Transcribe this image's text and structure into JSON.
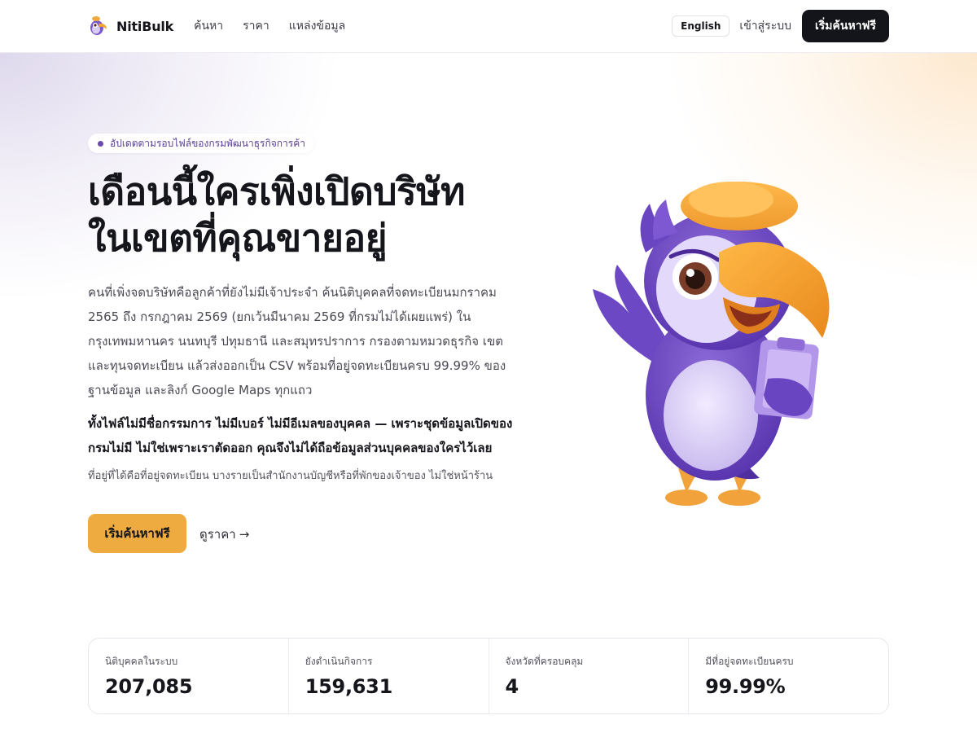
{
  "nav": {
    "brand": "NitiBulk",
    "links": [
      "ค้นหา",
      "ราคา",
      "แหล่งข้อมูล"
    ],
    "language": "English",
    "login": "เข้าสู่ระบบ",
    "cta": "เริ่มค้นหาฟรี"
  },
  "hero": {
    "badge": "อัปเดตตามรอบไฟล์ของกรมพัฒนาธุรกิจการค้า",
    "title_line1": "เดือนนี้ใครเพิ่งเปิดบริษัท",
    "title_line2": "ในเขตที่คุณขายอยู่",
    "description": "คนที่เพิ่งจดบริษัทคือลูกค้าที่ยังไม่มีเจ้าประจำ ค้นนิติบุคคลที่จดทะเบียนมกราคม 2565 ถึง กรกฎาคม 2569 (ยกเว้นมีนาคม 2569 ที่กรมไม่ได้เผยแพร่) ในกรุงเทพมหานคร นนทบุรี ปทุมธานี และสมุทรปราการ กรองตามหมวดธุรกิจ เขต และทุนจดทะเบียน แล้วส่งออกเป็น CSV พร้อมที่อยู่จดทะเบียนครบ 99.99% ของฐานข้อมูล และลิงก์ Google Maps ทุกแถว",
    "emphasis": "ทั้งไฟล์ไม่มีชื่อกรรมการ ไม่มีเบอร์ ไม่มีอีเมลของบุคคล — เพราะชุดข้อมูลเปิดของกรมไม่มี ไม่ใช่เพราะเราตัดออก คุณจึงไม่ได้ถือข้อมูลส่วนบุคคลของใครไว้เลย",
    "note": "ที่อยู่ที่ได้คือที่อยู่จดทะเบียน บางรายเป็นสำนักงานบัญชีหรือที่พักของเจ้าของ ไม่ใช่หน้าร้าน",
    "cta_primary": "เริ่มค้นหาฟรี",
    "cta_secondary": "ดูราคา",
    "cta_secondary_arrow": "→"
  },
  "stats": [
    {
      "label": "นิติบุคคลในระบบ",
      "value": "207,085"
    },
    {
      "label": "ยังดำเนินกิจการ",
      "value": "159,631"
    },
    {
      "label": "จังหวัดที่ครอบคลุม",
      "value": "4"
    },
    {
      "label": "มีที่อยู่จดทะเบียนครบ",
      "value": "99.99%"
    }
  ],
  "colors": {
    "accent": "#eeab3f",
    "dark": "#14141b",
    "brand_purple": "#6a4aa8"
  },
  "icons": {
    "logo": "parrot-logo-icon",
    "mascot": "parrot-mascot-illustration",
    "arrow": "arrow-right-icon"
  }
}
